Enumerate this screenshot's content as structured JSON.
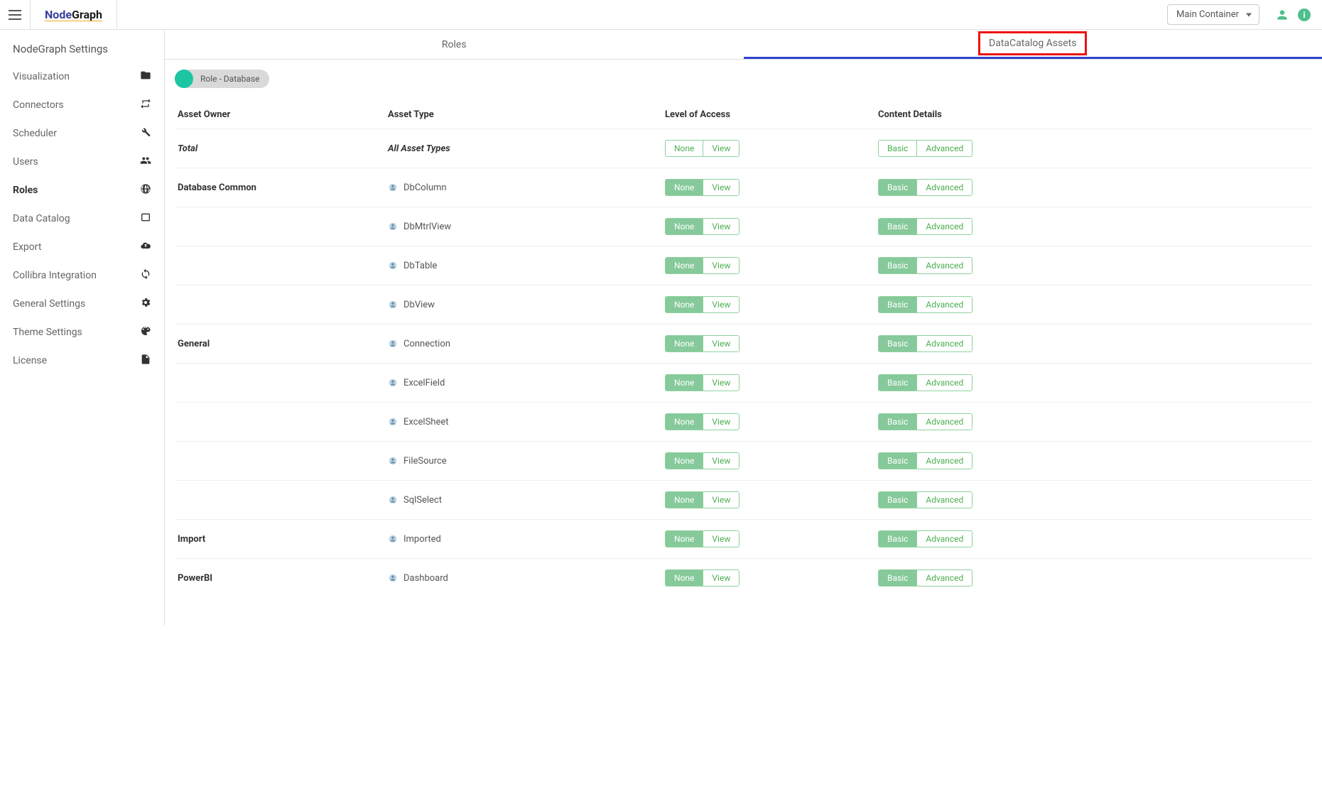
{
  "header": {
    "logo_node": "Node",
    "logo_graph": "Graph",
    "container_label": "Main Container"
  },
  "sidebar": {
    "title": "NodeGraph Settings",
    "items": [
      {
        "label": "Visualization",
        "icon": "folder"
      },
      {
        "label": "Connectors",
        "icon": "swap"
      },
      {
        "label": "Scheduler",
        "icon": "wrench"
      },
      {
        "label": "Users",
        "icon": "group"
      },
      {
        "label": "Roles",
        "icon": "globe",
        "active": true
      },
      {
        "label": "Data Catalog",
        "icon": "tablet"
      },
      {
        "label": "Export",
        "icon": "cloud"
      },
      {
        "label": "Collibra Integration",
        "icon": "sync"
      },
      {
        "label": "General Settings",
        "icon": "gear"
      },
      {
        "label": "Theme Settings",
        "icon": "palette"
      },
      {
        "label": "License",
        "icon": "file"
      }
    ]
  },
  "tabs": {
    "roles": "Roles",
    "assets": "DataCatalog Assets"
  },
  "chip": {
    "label": "Role - Database"
  },
  "columns": {
    "owner": "Asset Owner",
    "type": "Asset Type",
    "access": "Level of Access",
    "details": "Content Details"
  },
  "pill_labels": {
    "none": "None",
    "view": "View",
    "basic": "Basic",
    "advanced": "Advanced"
  },
  "rows": [
    {
      "owner": "Total",
      "type": "All Asset Types",
      "is_total": true
    },
    {
      "owner": "Database Common",
      "type": "DbColumn"
    },
    {
      "owner": "",
      "type": "DbMtrlView"
    },
    {
      "owner": "",
      "type": "DbTable"
    },
    {
      "owner": "",
      "type": "DbView"
    },
    {
      "owner": "General",
      "type": "Connection"
    },
    {
      "owner": "",
      "type": "ExcelField"
    },
    {
      "owner": "",
      "type": "ExcelSheet"
    },
    {
      "owner": "",
      "type": "FileSource"
    },
    {
      "owner": "",
      "type": "SqlSelect"
    },
    {
      "owner": "Import",
      "type": "Imported"
    },
    {
      "owner": "PowerBI",
      "type": "Dashboard"
    }
  ]
}
